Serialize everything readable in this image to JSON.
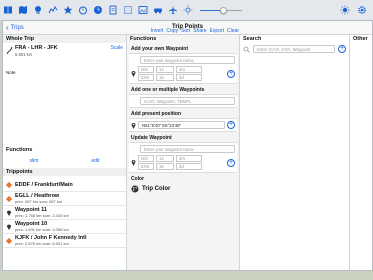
{
  "toolbar": {
    "icons": [
      "book-icon",
      "map-icon",
      "route-icon",
      "graph-icon",
      "star-icon",
      "timer-icon",
      "clock-icon",
      "document-icon",
      "grid-icon",
      "picture-icon",
      "car-icon",
      "airplane-icon",
      "sun-icon",
      "brightness-icon",
      "settings-icon"
    ],
    "brightness_level": 0.55
  },
  "dialog": {
    "back_label": "Trips",
    "title": "Trip Points"
  },
  "whole_trip": {
    "header": "Whole Trip",
    "trip_name": "FRA - LHR - JFK",
    "trip_dist": "5.901 km",
    "note_label": "Note",
    "actions": [
      "Scale",
      "Invert",
      "Copy",
      "Sort",
      "Share",
      "Export",
      "Clear"
    ]
  },
  "functions_left": {
    "header": "Functions",
    "slim": "slim",
    "edit": "edit"
  },
  "trippoints": {
    "header": "Trippoints",
    "items": [
      {
        "title": "EDDF / Frankfurt/Main",
        "sub": "",
        "color": "#e8762a"
      },
      {
        "title": "EGLL / Heathrow",
        "sub": "prec: 657 km sum: 657 km",
        "color": "#e8762a"
      },
      {
        "title": "Waypoint 11",
        "sub": "prec: 1.768 km sum: 2.425 km",
        "color": "#333333"
      },
      {
        "title": "Waypoint 10",
        "sub": "prec: 1.631 km sum: 4.056 km",
        "color": "#333333"
      },
      {
        "title": "KJFK / John F Kennedy Intl",
        "sub": "prec: 2.876 km sum: 6.931 km",
        "color": "#e8762a"
      }
    ]
  },
  "functions_mid": {
    "header": "Functions",
    "add_own": {
      "header": "Add your own Waypoint",
      "name_placeholder": "Enter your waypoint name",
      "lat_dir": "N/S",
      "lat_deg": "12",
      "lat_min": "4m",
      "lon_dir": "E/W",
      "lon_deg": "16",
      "lon_min": "3d"
    },
    "add_multiple": {
      "header": "Add one or multiple Waypoints",
      "placeholder": "ICAO, Waypoint, TEMPL"
    },
    "add_present": {
      "header": "Add present position",
      "coords": "N51°6'40\"  E8°23'48\""
    },
    "update": {
      "header": "Update Waypoint",
      "name_placeholder": "Enter your waypoint name",
      "lat_dir": "N/S",
      "lat_deg": "12",
      "lat_min": "2m",
      "lon_dir": "E/W",
      "lon_deg": "16",
      "lon_min": "3d"
    },
    "color": {
      "header": "Color",
      "label": "Trip Color"
    }
  },
  "search": {
    "header": "Search",
    "placeholder": "Enter ICAO, IATA, Waypoint"
  },
  "other": {
    "header": "Other"
  },
  "colors": {
    "accent": "#1a63d6",
    "airport_marker": "#e8762a"
  }
}
